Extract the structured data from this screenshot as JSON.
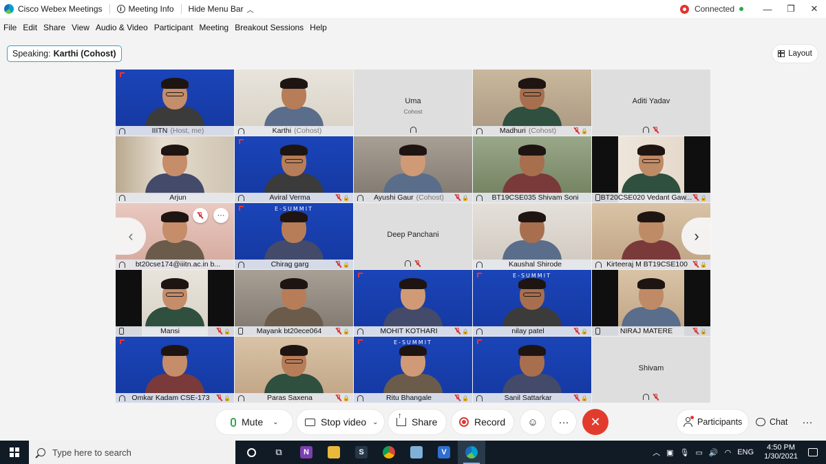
{
  "titlebar": {
    "app_title": "Cisco Webex Meetings",
    "meeting_info": "Meeting Info",
    "hide_menu_bar": "Hide Menu Bar",
    "status": "Connected"
  },
  "menu": [
    "File",
    "Edit",
    "Share",
    "View",
    "Audio & Video",
    "Participant",
    "Meeting",
    "Breakout Sessions",
    "Help"
  ],
  "speaking": {
    "label": "Speaking:",
    "name": "Karthi (Cohost)"
  },
  "layout_label": "Layout",
  "tiles": [
    {
      "name": "IIITN",
      "role": "(Host, me)",
      "bg": "blue",
      "active": true,
      "icon": "headset",
      "muted": false
    },
    {
      "name": "Karthi",
      "role": "(Cohost)",
      "bg": "room1",
      "active": true,
      "icon": "headset",
      "muted": false
    },
    {
      "name": "Uma",
      "sub": "Cohost",
      "empty": true,
      "icon": "headset",
      "muted": false
    },
    {
      "name": "Madhuri",
      "role": "(Cohost)",
      "bg": "room3",
      "icon": "headset",
      "muted": true
    },
    {
      "name": "Aditi Yadav",
      "empty": true,
      "icon": "headset",
      "muted": true
    },
    {
      "name": "Arjun",
      "bg": "room2",
      "icon": "headset",
      "muted": false
    },
    {
      "name": "Aviral Verma",
      "bg": "blue",
      "icon": "headset",
      "muted": true
    },
    {
      "name": "Ayushi Gaur",
      "role": "(Cohost)",
      "bg": "grey",
      "icon": "headset",
      "muted": true
    },
    {
      "name": "BT19CSE035 Shivam Soni",
      "bg": "green",
      "icon": "headset",
      "muted": false
    },
    {
      "name": "BT20CSE020 Vedant Gaw...",
      "bg": "wall",
      "bands": true,
      "icon": "phone",
      "muted": true
    },
    {
      "name": "bt20cse174@iiitn.ac.in b...",
      "bg": "pink",
      "icon": "headset",
      "muted": false,
      "controls": true
    },
    {
      "name": "Chirag garg",
      "bg": "blue",
      "esummit": true,
      "icon": "headset",
      "muted": true
    },
    {
      "name": "Deep Panchani",
      "empty": true,
      "icon": "headset",
      "muted": true
    },
    {
      "name": "Kaushal Shirode",
      "bg": "room4",
      "icon": "headset",
      "muted": false
    },
    {
      "name": "Kirteeraj M BT19CSE100",
      "bg": "warm",
      "icon": "headset",
      "muted": true
    },
    {
      "name": "Mansi",
      "bg": "room1",
      "bands": true,
      "icon": "phone",
      "muted": true
    },
    {
      "name": "Mayank bt20ece064",
      "bg": "grey",
      "icon": "phone",
      "muted": true
    },
    {
      "name": "MOHIT KOTHARI",
      "bg": "blue",
      "icon": "headset",
      "muted": true
    },
    {
      "name": "nilay patel",
      "bg": "blue",
      "esummit": true,
      "icon": "headset",
      "muted": true
    },
    {
      "name": "NIRAJ MATERE",
      "bg": "warm",
      "bands": true,
      "icon": "phone",
      "muted": true
    },
    {
      "name": "Omkar Kadam CSE-173",
      "bg": "blue",
      "icon": "headset",
      "muted": true
    },
    {
      "name": "Paras Saxena",
      "bg": "warm",
      "icon": "headset",
      "muted": true
    },
    {
      "name": "Ritu Bhangale",
      "bg": "blue",
      "esummit": true,
      "icon": "headset",
      "muted": true
    },
    {
      "name": "Sanil Sattarkar",
      "bg": "blue",
      "icon": "headset",
      "muted": true
    },
    {
      "name": "Shivam",
      "empty": true,
      "icon": "headset",
      "muted": true
    }
  ],
  "esummit_text": "E-SUMMIT",
  "controls": {
    "mute": "Mute",
    "stop_video": "Stop video",
    "share": "Share",
    "record": "Record",
    "participants": "Participants",
    "chat": "Chat"
  },
  "taskbar": {
    "search_placeholder": "Type here to search",
    "language": "ENG",
    "time": "4:50 PM",
    "date": "1/30/2021"
  }
}
